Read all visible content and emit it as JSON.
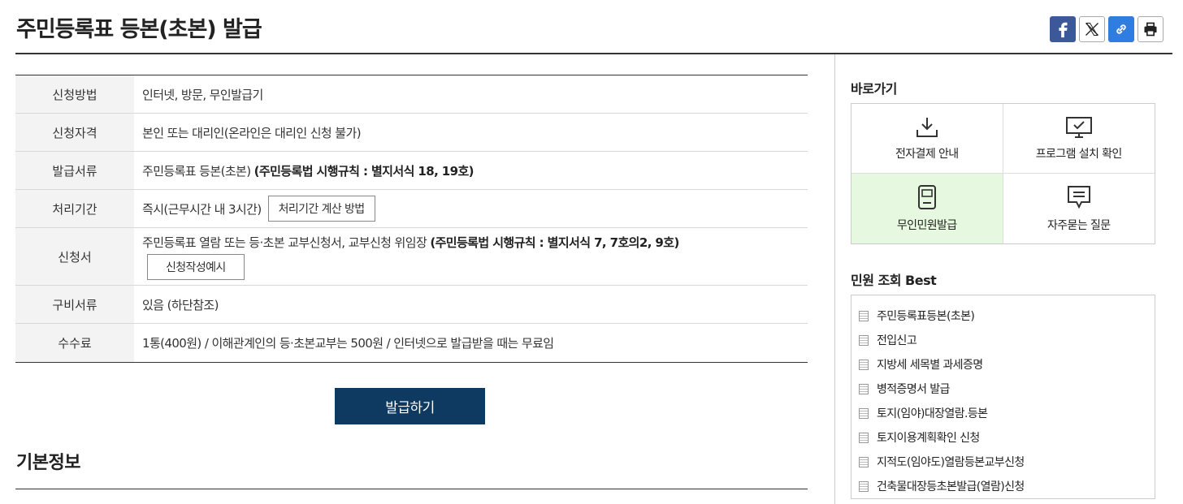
{
  "page": {
    "title": "주민등록표 등본(초본) 발급"
  },
  "share": {
    "facebook_icon": "facebook-icon",
    "x_icon": "x-icon",
    "link_icon": "link-icon",
    "print_icon": "print-icon"
  },
  "info_rows": [
    {
      "label": "신청방법",
      "text": "인터넷, 방문, 무인발급기"
    },
    {
      "label": "신청자격",
      "text": "본인 또는 대리인(온라인은 대리인 신청 불가)"
    },
    {
      "label": "발급서류",
      "text": "주민등록표 등본(초본) ",
      "bold": "(주민등록법 시행규칙 : 별지서식 18, 19호)"
    },
    {
      "label": "처리기간",
      "text": "즉시(근무시간 내 3시간)",
      "button": "처리기간 계산 방법"
    },
    {
      "label": "신청서",
      "text": "주민등록표 열람 또는 등·초본 교부신청서, 교부신청 위임장 ",
      "bold": "(주민등록법 시행규칙 : 별지서식 7, 7호의2, 9호)",
      "button": "신청작성예시"
    },
    {
      "label": "구비서류",
      "text": "있음 (하단참조)"
    },
    {
      "label": "수수료",
      "text": "1통(400원) / 이해관계인의 등·초본교부는 500원 / 인터넷으로 발급받을 때는 무료임"
    }
  ],
  "issue_button": "발급하기",
  "basic_info_title": "기본정보",
  "sidebar": {
    "shortcut_title": "바로가기",
    "shortcuts": [
      {
        "label": "전자결제 안내",
        "icon": "download-icon"
      },
      {
        "label": "프로그램 설치 확인",
        "icon": "monitor-check-icon"
      },
      {
        "label": "무인민원발급",
        "icon": "kiosk-icon"
      },
      {
        "label": "자주묻는 질문",
        "icon": "speech-bubble-icon"
      }
    ],
    "best_title": "민원 조회 Best",
    "best_items": [
      "주민등록표등본(초본)",
      "전입신고",
      "지방세 세목별 과세증명",
      "병적증명서 발급",
      "토지(임야)대장열람.등본",
      "토지이용계획확인 신청",
      "지적도(임야도)열람등본교부신청",
      "건축물대장등초본발급(열람)신청"
    ]
  },
  "colors": {
    "primary_button": "#0e3a62",
    "active_tile": "#e6f9e0",
    "facebook": "#3b5998",
    "link": "#2f7de1"
  }
}
